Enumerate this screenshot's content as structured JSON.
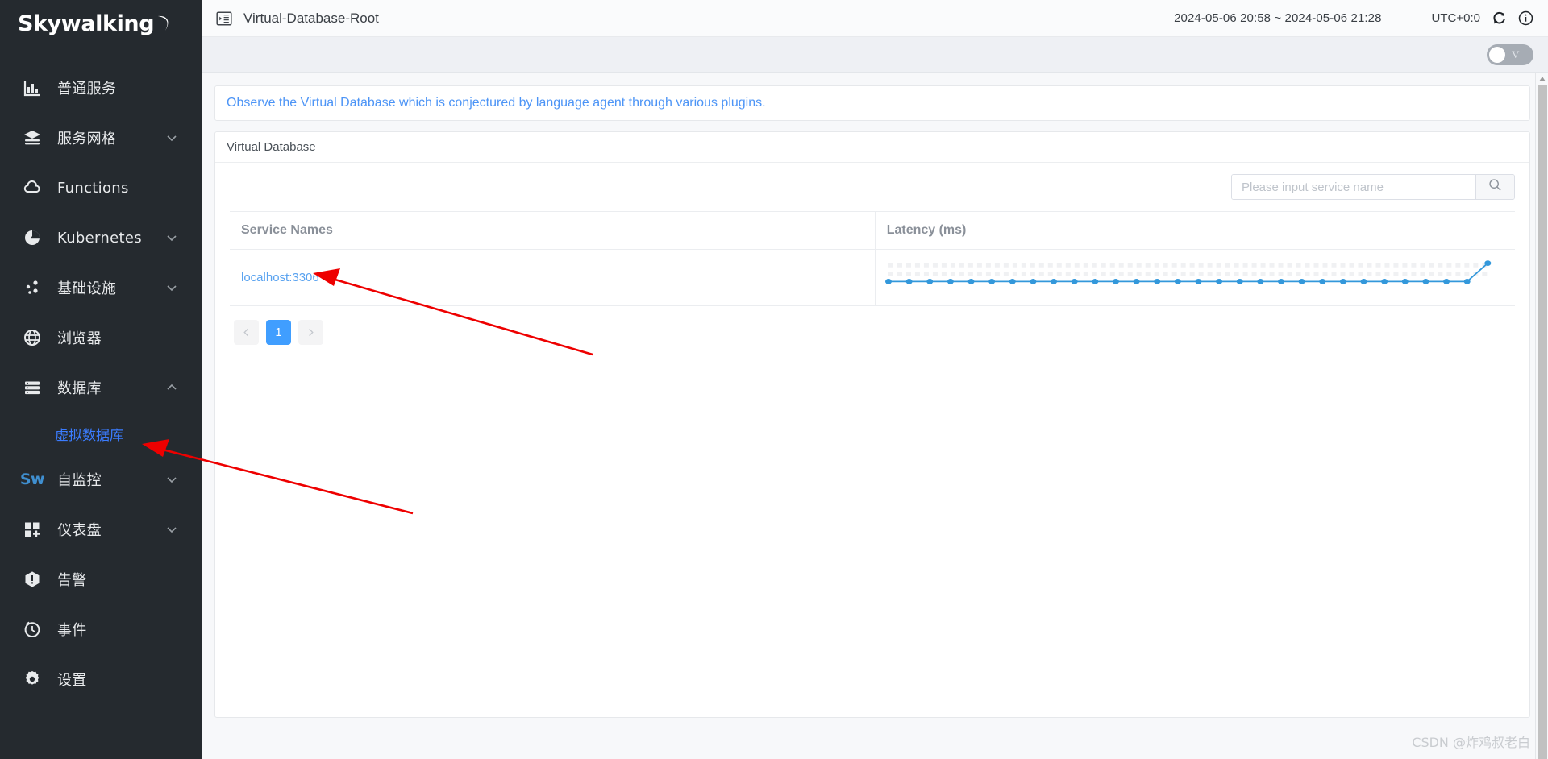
{
  "brand": {
    "name": "Skywalking",
    "logo_icon": "moon-icon"
  },
  "sidebar": {
    "items": [
      {
        "label": "普通服务",
        "icon": "chart-bar-icon",
        "expandable": false
      },
      {
        "label": "服务网格",
        "icon": "layers-icon",
        "expandable": true
      },
      {
        "label": "Functions",
        "icon": "cloud-icon",
        "expandable": false
      },
      {
        "label": "Kubernetes",
        "icon": "pie-chart-icon",
        "expandable": true
      },
      {
        "label": "基础设施",
        "icon": "nodes-icon",
        "expandable": true
      },
      {
        "label": "浏览器",
        "icon": "globe-icon",
        "expandable": false
      },
      {
        "label": "数据库",
        "icon": "database-list-icon",
        "expandable": true
      },
      {
        "label": "自监控",
        "icon": "sw-logo-icon",
        "expandable": true
      },
      {
        "label": "仪表盘",
        "icon": "dashboard-add-icon",
        "expandable": true
      },
      {
        "label": "告警",
        "icon": "alarm-hexagon-icon",
        "expandable": false
      },
      {
        "label": "事件",
        "icon": "event-clock-icon",
        "expandable": false
      },
      {
        "label": "设置",
        "icon": "gear-icon",
        "expandable": false
      }
    ],
    "submenu": {
      "label": "虚拟数据库",
      "parent": "数据库"
    },
    "sw_mark": "Sw"
  },
  "topbar": {
    "collapse_icon": "collapse-sidebar-icon",
    "title": "Virtual-Database-Root",
    "time_range": "2024-05-06 20:58 ~ 2024-05-06 21:28",
    "timezone": "UTC+0:0",
    "refresh_icon": "refresh-icon",
    "info_icon": "info-circle-icon"
  },
  "subbar": {
    "toggle_label": "V",
    "toggle_on": false
  },
  "banner": {
    "text": "Observe the Virtual Database which is conjectured by language agent through various plugins."
  },
  "panel": {
    "title": "Virtual Database",
    "search": {
      "placeholder": "Please input service name",
      "value": "",
      "icon": "search-icon"
    },
    "table": {
      "columns": [
        "Service Names",
        "Latency (ms)"
      ],
      "rows": [
        {
          "service": "localhost:3306"
        }
      ]
    },
    "pagination": {
      "prev_icon": "chevron-left-icon",
      "pages": [
        "1"
      ],
      "current": "1",
      "next_icon": "chevron-right-icon"
    }
  },
  "chart_data": {
    "type": "line",
    "title": "Latency (ms)",
    "xlabel": "",
    "ylabel": "Latency (ms)",
    "grid": true,
    "legend": false,
    "color": "#3398db",
    "x": [
      1,
      2,
      3,
      4,
      5,
      6,
      7,
      8,
      9,
      10,
      11,
      12,
      13,
      14,
      15,
      16,
      17,
      18,
      19,
      20,
      21,
      22,
      23,
      24,
      25,
      26,
      27,
      28,
      29,
      30
    ],
    "values": [
      1,
      1,
      1,
      1,
      1,
      1,
      1,
      1,
      1,
      1,
      1,
      1,
      1,
      1,
      1,
      1,
      1,
      1,
      1,
      1,
      1,
      1,
      1,
      1,
      1,
      1,
      1,
      1,
      1,
      4
    ],
    "ylim": [
      0,
      5
    ]
  },
  "annotations": {
    "arrows": [
      {
        "name": "arrow-to-service-link"
      },
      {
        "name": "arrow-to-virtual-database-menu"
      }
    ],
    "watermark": "CSDN @炸鸡叔老白"
  },
  "colors": {
    "sidebar_bg": "#252a2f",
    "accent_blue": "#409eff",
    "link_blue": "#5aa3f0",
    "banner_blue": "#4c94f6",
    "chart_blue": "#3398db",
    "annotation_red": "#ee0000"
  }
}
